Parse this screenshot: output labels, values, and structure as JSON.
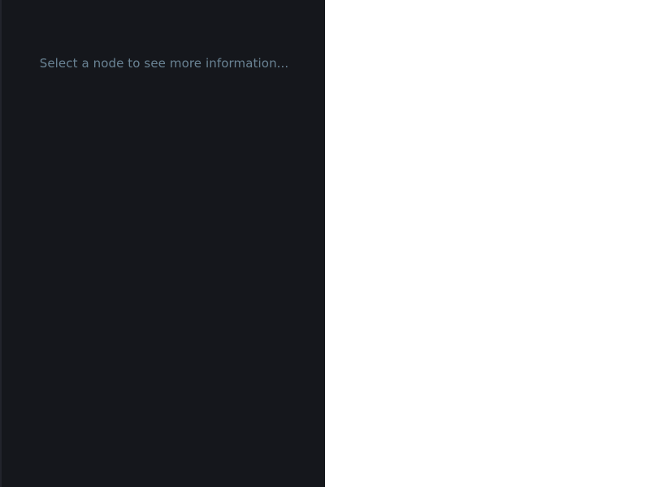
{
  "info_panel": {
    "placeholder": "Select a node to see more information..."
  },
  "colors": {
    "panel_background": "#15171c",
    "placeholder_text": "#6a8394",
    "canvas_background": "#ffffff"
  }
}
